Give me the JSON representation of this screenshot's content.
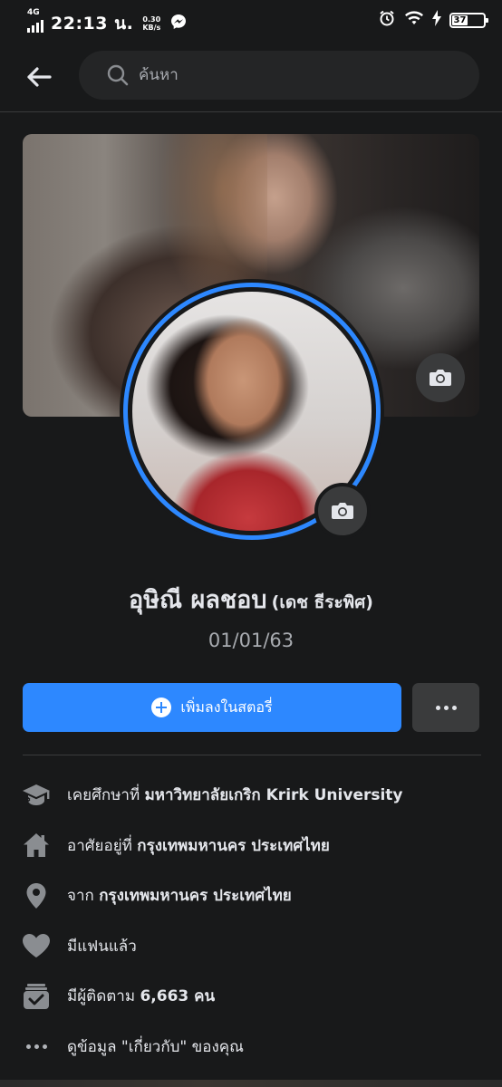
{
  "status_bar": {
    "network": "4G",
    "time": "22:13 น.",
    "speed_value": "0.30",
    "speed_unit": "KB/s",
    "battery": "37"
  },
  "header": {
    "back_icon": "arrow-left-icon",
    "search_placeholder": "ค้นหา"
  },
  "profile": {
    "name": "อุษิณี ผลชอบ",
    "alternate_name": "(เดช ธีระพิศ)",
    "subtitle": "01/01/63"
  },
  "actions": {
    "add_story_label": "เพิ่มลงในสตอรี่"
  },
  "details": [
    {
      "icon": "graduation-cap-icon",
      "prefix": "เคยศึกษาที่ ",
      "value": "มหาวิทยาลัยเกริก Krirk University",
      "suffix": ""
    },
    {
      "icon": "home-icon",
      "prefix": "อาศัยอยู่ที่ ",
      "value": "กรุงเทพมหานคร ประเทศไทย",
      "suffix": ""
    },
    {
      "icon": "location-pin-icon",
      "prefix": "จาก ",
      "value": "กรุงเทพมหานคร ประเทศไทย",
      "suffix": ""
    },
    {
      "icon": "heart-icon",
      "prefix": "มีแฟนแล้ว",
      "value": "",
      "suffix": ""
    },
    {
      "icon": "followers-icon",
      "prefix": "มีผู้ติดตาม ",
      "value": "6,663 คน",
      "suffix": ""
    },
    {
      "icon": "more-dots-icon",
      "prefix": "ดูข้อมูล \"เกี่ยวกับ\" ของคุณ",
      "value": "",
      "suffix": ""
    }
  ],
  "colors": {
    "background": "#18191a",
    "accent": "#2d88ff",
    "secondary_button": "#3a3b3c"
  }
}
